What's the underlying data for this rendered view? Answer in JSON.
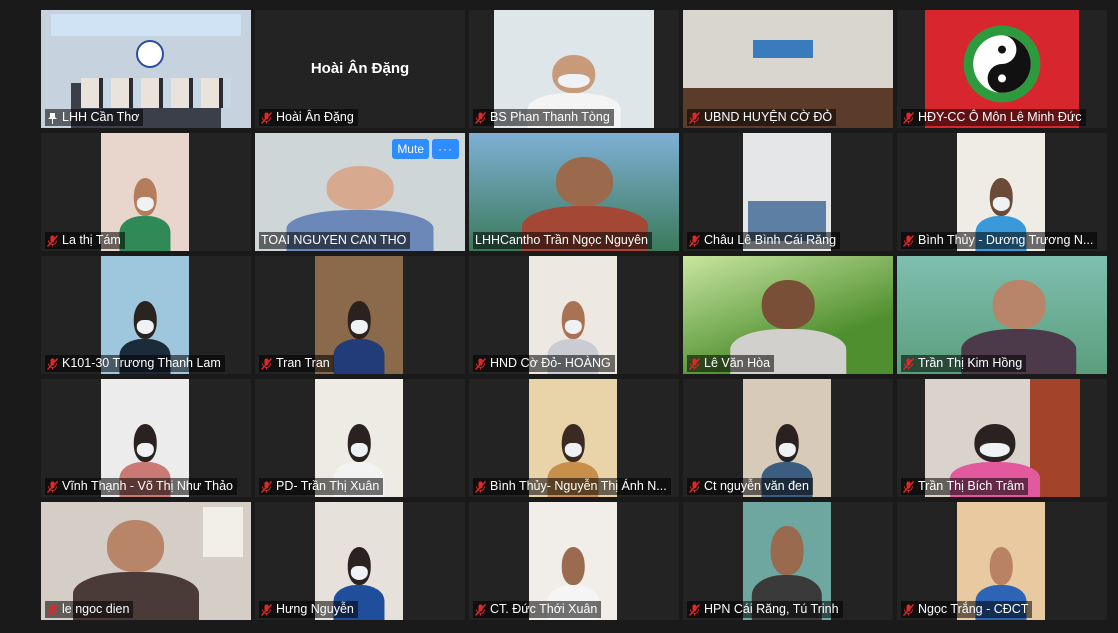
{
  "meeting": {
    "mute_label": "Mute",
    "more_label": "···"
  },
  "participants": [
    {
      "name": "LHH Cần Thơ",
      "pinned": true
    },
    {
      "name": "Hoài Ân Đặng",
      "display": "Hoài Ân Đặng"
    },
    {
      "name": "BS Phan Thanh Tòng"
    },
    {
      "name": "UBND HUYỆN CỜ ĐỎ"
    },
    {
      "name": "HĐY-CC Ô Môn Lê Minh Đức"
    },
    {
      "name": "La thị  Tám"
    },
    {
      "name": "TOAI NGUYEN CAN THO",
      "active": true
    },
    {
      "name": "LHHCantho Trần Ngọc Nguyên"
    },
    {
      "name": "Châu Lê Bình Cái Răng"
    },
    {
      "name": "Bình Thủy - Dương Trương N..."
    },
    {
      "name": "K101-30 Trương Thanh Lam"
    },
    {
      "name": "Tran Tran"
    },
    {
      "name": "HND Cờ Đỏ- HOÀNG"
    },
    {
      "name": "Lê Văn Hòa"
    },
    {
      "name": "Trần Thị Kim Hồng"
    },
    {
      "name": "Vĩnh Thạnh - Võ Thị Như Thảo"
    },
    {
      "name": "PD- Trần Thị Xuân"
    },
    {
      "name": "Bình Thủy- Nguyễn Thị Ánh N..."
    },
    {
      "name": "Ct nguyễn văn đen"
    },
    {
      "name": "Trần Thị Bích Trâm"
    },
    {
      "name": "le ngoc dien"
    },
    {
      "name": "Hưng Nguyễn"
    },
    {
      "name": "CT. Đức Thới Xuân"
    },
    {
      "name": "HPN Cái Răng, Tú Trinh"
    },
    {
      "name": "Ngọc Trắng - CĐCT"
    }
  ]
}
